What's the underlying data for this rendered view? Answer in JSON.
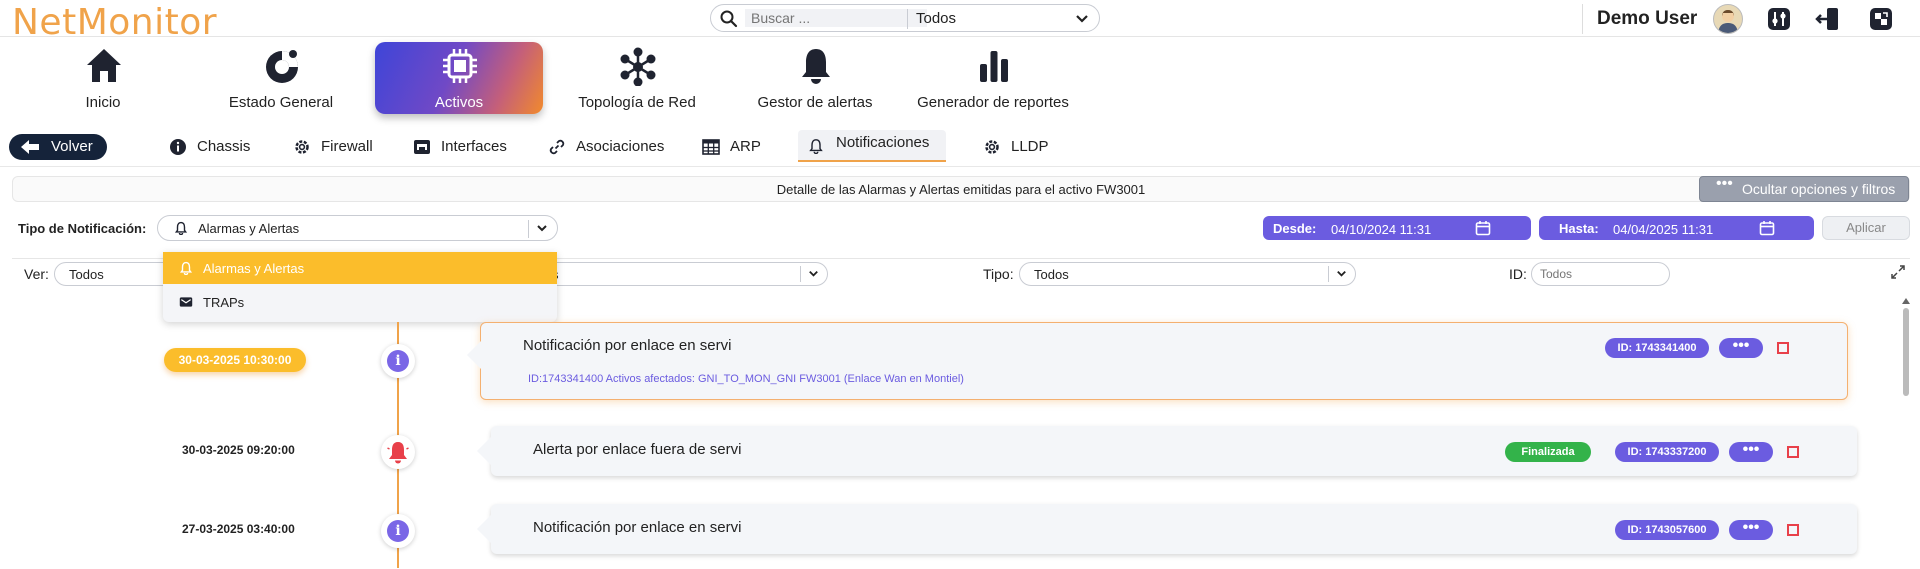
{
  "app": {
    "logo_text": "NetMonitor",
    "logo_color": "#f0a34a"
  },
  "search": {
    "placeholder": "Buscar ...",
    "scope_value": "Todos"
  },
  "user": {
    "name": "Demo User"
  },
  "main_nav": {
    "items": [
      {
        "label": "Inicio",
        "icon": "home-icon"
      },
      {
        "label": "Estado General",
        "icon": "gauge-icon"
      },
      {
        "label": "Activos",
        "icon": "chip-icon",
        "active": true
      },
      {
        "label": "Topología de Red",
        "icon": "network-icon"
      },
      {
        "label": "Gestor de alertas",
        "icon": "bell-icon"
      },
      {
        "label": "Generador de reportes",
        "icon": "bar-chart-icon"
      }
    ]
  },
  "sub_nav": {
    "back_label": "Volver",
    "tabs": [
      {
        "label": "Chassis",
        "icon": "info-icon"
      },
      {
        "label": "Firewall",
        "icon": "gear-icon"
      },
      {
        "label": "Interfaces",
        "icon": "interface-icon"
      },
      {
        "label": "Asociaciones",
        "icon": "link-icon"
      },
      {
        "label": "ARP",
        "icon": "table-icon"
      },
      {
        "label": "Notificaciones",
        "icon": "bell-icon",
        "active": true
      },
      {
        "label": "LLDP",
        "icon": "gear-icon"
      }
    ]
  },
  "detail": {
    "text": "Detalle de las Alarmas y Alertas emitidas para el activo FW3001",
    "toggle_label": "Ocultar opciones y filtros"
  },
  "filters": {
    "type_label": "Tipo de Notificación:",
    "type_value": "Alarmas y Alertas",
    "type_options": [
      "Alarmas y Alertas",
      "TRAPs"
    ],
    "desde_label": "Desde:",
    "desde_value": "04/10/2024 11:31",
    "hasta_label": "Hasta:",
    "hasta_value": "04/04/2025 11:31",
    "apply_label": "Aplicar",
    "ver_label": "Ver:",
    "ver_value": "Todos",
    "second_value_tail": "s",
    "tipo_label": "Tipo:",
    "tipo_value": "Todos",
    "id_label": "ID:",
    "id_placeholder": "Todos"
  },
  "timeline": [
    {
      "datetime": "30-03-2025 10:30:00",
      "icon": "info-icon",
      "title": "Notificación por enlace en servi",
      "subtitle": "ID:1743341400 Activos afectados: GNI_TO_MON_GNI FW3001 (Enlace Wan en Montiel)",
      "id_badge": "ID: 1743341400",
      "status": "",
      "highlighted": true
    },
    {
      "datetime": "30-03-2025 09:20:00",
      "icon": "bell-alert-icon",
      "title": "Alerta por enlace fuera de servi",
      "subtitle": "",
      "id_badge": "ID: 1743337200",
      "status": "Finalizada"
    },
    {
      "datetime": "27-03-2025 03:40:00",
      "icon": "info-icon",
      "title": "Notificación por enlace en servi",
      "subtitle": "",
      "id_badge": "ID: 1743057600",
      "status": ""
    }
  ],
  "colors": {
    "accent_orange": "#f0a34a",
    "accent_purple": "#6b5ce0",
    "highlight_yellow": "#fbbd2b",
    "status_green": "#33b34a",
    "alert_red": "#e8404a",
    "dark_button": "#15233a"
  }
}
